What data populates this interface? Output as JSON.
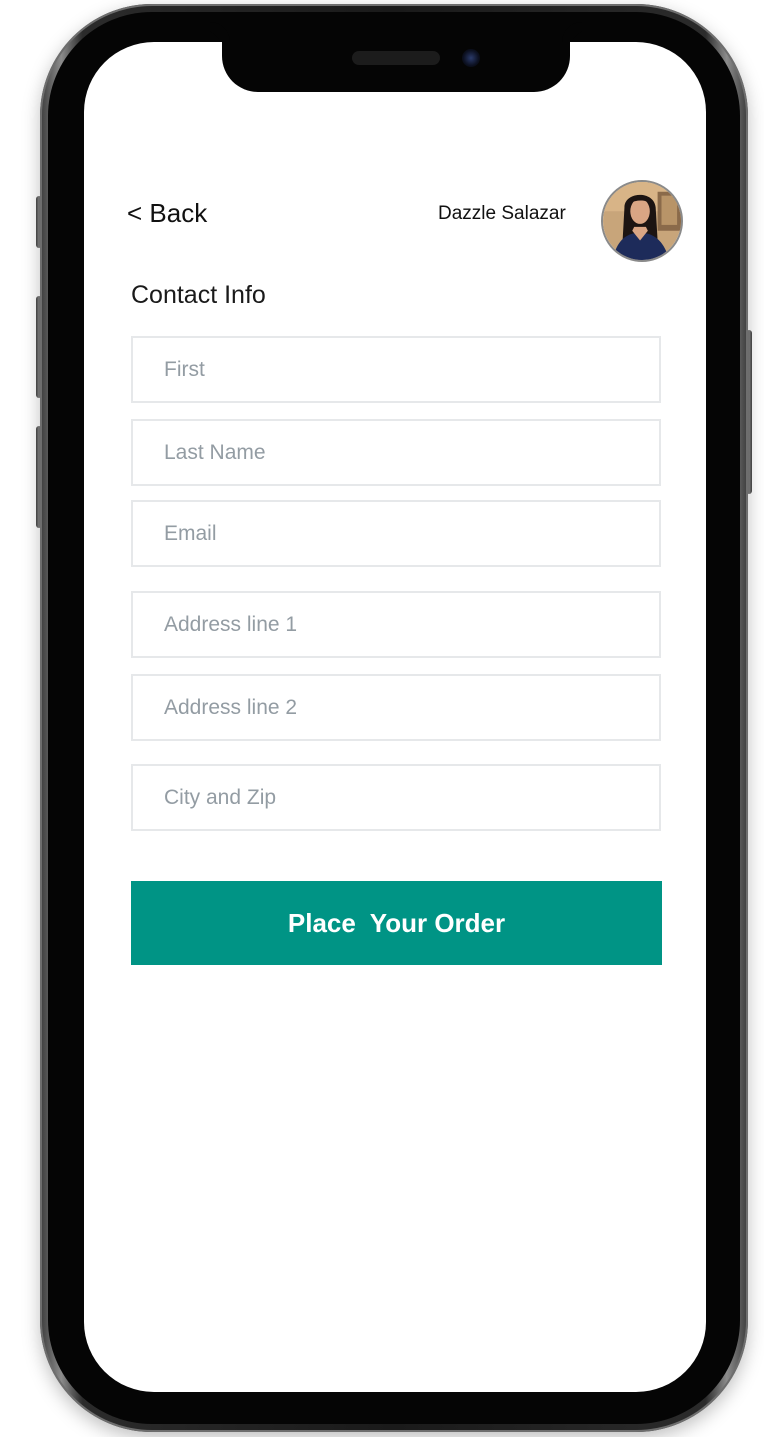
{
  "header": {
    "back_label": "< Back",
    "user_name": "Dazzle Salazar"
  },
  "form": {
    "title": "Contact Info",
    "fields": {
      "first": {
        "placeholder": "First",
        "value": ""
      },
      "last_name": {
        "placeholder": "Last Name",
        "value": ""
      },
      "email": {
        "placeholder": "Email",
        "value": ""
      },
      "address_line_1": {
        "placeholder": "Address line 1",
        "value": ""
      },
      "address_line_2": {
        "placeholder": "Address line 2",
        "value": ""
      },
      "city_zip": {
        "placeholder": "City and Zip",
        "value": ""
      }
    },
    "submit_label": "Place  Your Order"
  },
  "theme": {
    "accent": "#009485",
    "field_border": "#e6e8ea",
    "placeholder_color": "#939ca3"
  },
  "icons": {
    "avatar": "user-avatar-photo"
  }
}
